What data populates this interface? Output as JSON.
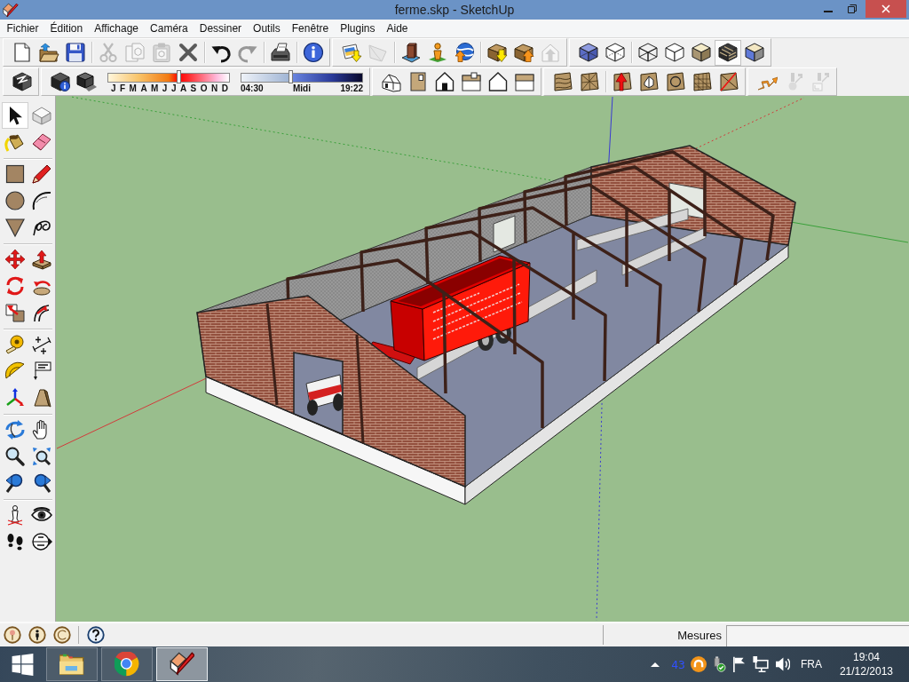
{
  "window": {
    "title": "ferme.skp - SketchUp"
  },
  "menu": [
    "Fichier",
    "Édition",
    "Affichage",
    "Caméra",
    "Dessiner",
    "Outils",
    "Fenêtre",
    "Plugins",
    "Aide"
  ],
  "toolbars_row_1": [
    {
      "groups": [
        [
          {
            "disabled": false,
            "selected": false
          },
          {
            "disabled": false,
            "selected": false
          },
          {
            "disabled": false,
            "selected": false
          }
        ],
        [
          {
            "disabled": true,
            "selected": false
          },
          {
            "disabled": true,
            "selected": false
          },
          {
            "disabled": true,
            "selected": false
          },
          {
            "disabled": false,
            "selected": false
          }
        ],
        [
          {
            "disabled": false,
            "selected": false
          },
          {
            "disabled": true,
            "selected": false
          }
        ],
        [
          {
            "disabled": false,
            "selected": false
          }
        ],
        [
          {
            "disabled": false,
            "selected": false
          }
        ]
      ]
    },
    {
      "groups": [
        [
          {
            "disabled": false,
            "selected": false
          },
          {
            "disabled": true,
            "selected": false
          }
        ],
        [
          {
            "disabled": false,
            "selected": false
          },
          {
            "disabled": false,
            "selected": false
          },
          {
            "disabled": false,
            "selected": false
          }
        ],
        [
          {
            "disabled": false,
            "selected": false
          },
          {
            "disabled": false,
            "selected": false
          },
          {
            "disabled": true,
            "selected": false
          }
        ]
      ]
    },
    {
      "groups": [
        [
          {
            "disabled": false,
            "selected": false
          },
          {
            "disabled": false,
            "selected": false
          }
        ],
        [
          {
            "disabled": false,
            "selected": false
          },
          {
            "disabled": false,
            "selected": false
          },
          {
            "disabled": false,
            "selected": false
          },
          {
            "disabled": false,
            "selected": true
          },
          {
            "disabled": false,
            "selected": false
          }
        ]
      ]
    }
  ],
  "toolbars_row_2": [
    {
      "groups": [
        [
          {
            "disabled": false,
            "selected": false
          }
        ]
      ]
    },
    {
      "groups": [
        [
          {
            "disabled": false,
            "selected": false
          },
          {
            "disabled": false,
            "selected": false
          }
        ]
      ],
      "date_slider": {
        "level": 0.59,
        "months": [
          "J",
          "F",
          "M",
          "A",
          "M",
          "J",
          "J",
          "A",
          "S",
          "O",
          "N",
          "D"
        ]
      },
      "time_slider": {
        "level": 0.41,
        "start": "04:30",
        "middle": "Midi",
        "end": "19:22"
      }
    },
    {
      "groups": [
        [
          {
            "disabled": false,
            "selected": false
          },
          {
            "disabled": false,
            "selected": false
          },
          {
            "disabled": false,
            "selected": false
          },
          {
            "disabled": false,
            "selected": false
          },
          {
            "disabled": false,
            "selected": false
          },
          {
            "disabled": false,
            "selected": false
          }
        ]
      ]
    },
    {
      "groups": [
        [
          {
            "disabled": false,
            "selected": false
          },
          {
            "disabled": false,
            "selected": false
          }
        ],
        [
          {
            "disabled": false,
            "selected": false
          },
          {
            "disabled": false,
            "selected": false
          },
          {
            "disabled": false,
            "selected": false
          },
          {
            "disabled": false,
            "selected": false
          },
          {
            "disabled": false,
            "selected": false
          }
        ]
      ]
    },
    {
      "groups": [
        [
          {
            "disabled": false,
            "selected": false
          },
          {
            "disabled": true,
            "selected": false
          },
          {
            "disabled": true,
            "selected": false
          }
        ]
      ]
    }
  ],
  "tool_palette": {
    "groups": [
      [
        {
          "selected": true
        },
        {
          "selected": false
        },
        {
          "selected": false
        },
        {
          "selected": false
        }
      ],
      [
        {
          "selected": false
        },
        {
          "selected": false
        },
        {
          "selected": false
        },
        {
          "selected": false
        },
        {
          "selected": false
        },
        {
          "selected": false
        }
      ],
      [
        {
          "selected": false
        },
        {
          "selected": false
        },
        {
          "selected": false
        },
        {
          "selected": false
        },
        {
          "selected": false
        },
        {
          "selected": false
        }
      ],
      [
        {
          "selected": false
        },
        {
          "selected": false
        },
        {
          "selected": false
        },
        {
          "selected": false
        },
        {
          "selected": false
        },
        {
          "selected": false
        }
      ],
      [
        {
          "selected": false
        },
        {
          "selected": false
        },
        {
          "selected": false
        },
        {
          "selected": false
        },
        {
          "selected": false
        },
        {
          "selected": false
        }
      ],
      [
        {
          "selected": false
        },
        {
          "selected": false
        },
        {
          "selected": false
        },
        {
          "selected": false
        }
      ]
    ]
  },
  "status_bar": {
    "measurements_label": "Mesures"
  },
  "taskbar": {
    "apps": [
      {
        "selected": false
      },
      {
        "selected": false
      },
      {
        "selected": true
      }
    ],
    "tray": {
      "counter": "43",
      "language": "FRA",
      "time": "19:04",
      "date": "21/12/2013"
    }
  }
}
